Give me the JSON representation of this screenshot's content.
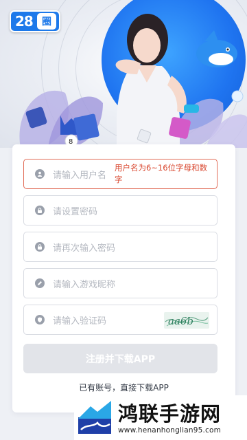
{
  "logo": {
    "number": "28",
    "badge": "圈"
  },
  "form": {
    "username": {
      "placeholder": "请输入用户名",
      "error": "用户名为6~16位字母和数字"
    },
    "password": {
      "placeholder": "请设置密码"
    },
    "confirm_password": {
      "placeholder": "请再次输入密码"
    },
    "nickname": {
      "placeholder": "请输入游戏昵称"
    },
    "captcha": {
      "placeholder": "请输入验证码",
      "image_text": "aa6b"
    },
    "submit_label": "注册并下载APP",
    "footer_text": "已有账号，直接下载APP"
  },
  "watermark": {
    "name": "鸿联手游网",
    "url": "www.henanhonglian95.com"
  },
  "colors": {
    "accent": "#1d79ea",
    "error": "#d9472f",
    "button_disabled": "#e2e4e9"
  }
}
